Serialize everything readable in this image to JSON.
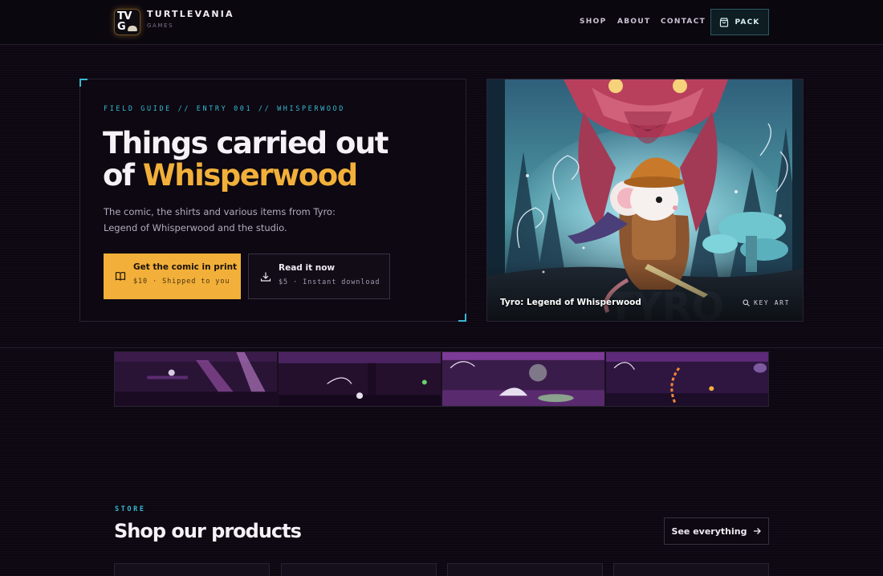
{
  "header": {
    "logo_text": "TVG",
    "brand_name": "TURTLEVANIA",
    "brand_sub": "GAMES",
    "nav": [
      "SHOP",
      "ABOUT",
      "CONTACT"
    ],
    "pack_label": "PACK"
  },
  "hero": {
    "eyebrow": "FIELD GUIDE // ENTRY 001 // WHISPERWOOD",
    "title_line1": "Things carried out",
    "title_of": "of",
    "title_accent": "Whisperwood",
    "description": "The comic, the shirts and various items from Tyro: Legend of Whisperwood and the studio.",
    "primary_button": {
      "label": "Get the comic in print",
      "sub": "$10 · Shipped to you"
    },
    "secondary_button": {
      "label": "Read it now",
      "sub": "$5 · Instant download"
    }
  },
  "key_art": {
    "caption": "Tyro: Legend of Whisperwood",
    "tag": "KEY ART"
  },
  "store": {
    "eyebrow": "STORE",
    "title": "Shop our products",
    "see_all": "See everything"
  },
  "colors": {
    "accent_gold": "#f2b03a",
    "accent_cyan": "#37b8d4",
    "background": "#0c0710"
  }
}
